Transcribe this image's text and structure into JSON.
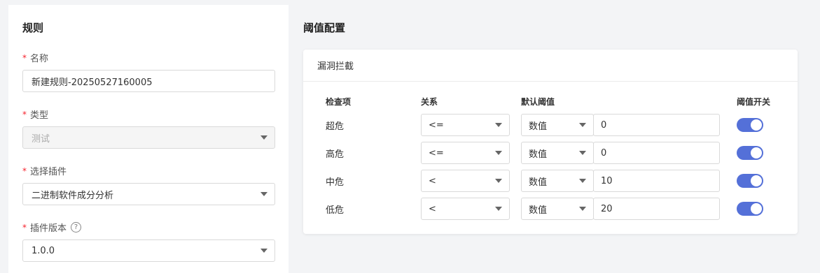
{
  "left": {
    "title": "规则",
    "fields": [
      {
        "label": "名称",
        "required": "*",
        "value": "新建规则-20250527160005"
      },
      {
        "label": "类型",
        "required": "*",
        "value": "测试"
      },
      {
        "label": "选择插件",
        "required": "*",
        "value": "二进制软件成分分析"
      },
      {
        "label": "插件版本",
        "required": "*",
        "value": "1.0.0",
        "help": "?"
      }
    ]
  },
  "right": {
    "title": "阈值配置",
    "card_title": "漏洞拦截",
    "headers": {
      "item": "检查项",
      "relation": "关系",
      "threshold": "默认阈值",
      "switch": "阈值开关"
    },
    "rows": [
      {
        "label": "超危",
        "relation": "<=",
        "type": "数值",
        "value": "0",
        "enabled": true
      },
      {
        "label": "高危",
        "relation": "<=",
        "type": "数值",
        "value": "0",
        "enabled": true
      },
      {
        "label": "中危",
        "relation": "<",
        "type": "数值",
        "value": "10",
        "enabled": true
      },
      {
        "label": "低危",
        "relation": "<",
        "type": "数值",
        "value": "20",
        "enabled": true
      }
    ]
  },
  "colors": {
    "toggle_on": "#5470d8",
    "required": "#f5222d",
    "background": "#f3f4f6"
  },
  "icons": {
    "dropdown": "caret-down-icon",
    "help": "help-circle-icon"
  }
}
